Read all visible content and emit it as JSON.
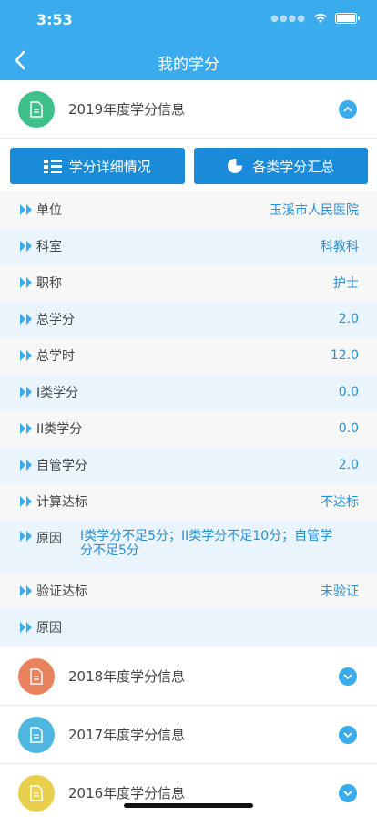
{
  "status": {
    "time": "3:53"
  },
  "nav": {
    "title": "我的学分"
  },
  "sections": [
    {
      "year_title": "2019年度学分信息",
      "color": "#3ec08a"
    },
    {
      "year_title": "2018年度学分信息",
      "color": "#e9835e"
    },
    {
      "year_title": "2017年度学分信息",
      "color": "#4fb6e2"
    },
    {
      "year_title": "2016年度学分信息",
      "color": "#e8cf4d"
    }
  ],
  "buttons": {
    "detail": "学分详细情况",
    "summary": "各类学分汇总"
  },
  "details": [
    {
      "label": "单位",
      "value": "玉溪市人民医院"
    },
    {
      "label": "科室",
      "value": "科教科"
    },
    {
      "label": "职称",
      "value": "护士"
    },
    {
      "label": "总学分",
      "value": "2.0"
    },
    {
      "label": "总学时",
      "value": "12.0"
    },
    {
      "label": "I类学分",
      "value": "0.0"
    },
    {
      "label": "II类学分",
      "value": "0.0"
    },
    {
      "label": "自管学分",
      "value": "2.0"
    },
    {
      "label": "计算达标",
      "value": "不达标"
    },
    {
      "label": "原因",
      "value": "I类学分不足5分；II类学分不足10分；自管学分不足5分"
    },
    {
      "label": "验证达标",
      "value": "未验证"
    },
    {
      "label": "原因",
      "value": ""
    }
  ],
  "colors": {
    "accent": "#3aabec",
    "button": "#1a8bd8",
    "value_text": "#2a8fd2"
  },
  "icons": {
    "back": "chevron-left-icon",
    "expand": "chevron-up-icon",
    "collapse": "chevron-down-icon",
    "doc": "document-icon",
    "list": "list-icon",
    "pie": "pie-chart-icon"
  }
}
